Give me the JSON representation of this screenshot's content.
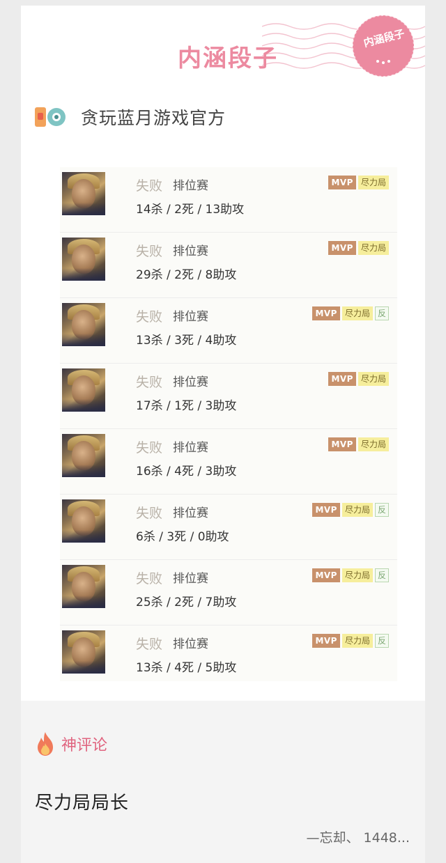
{
  "header": {
    "brand_title": "内涵段子",
    "stamp_text": "内涵段子",
    "brand_color": "#ec8aa0"
  },
  "author": {
    "icon": "game-app-icon",
    "name": "贪玩蓝月游戏官方"
  },
  "matches": [
    {
      "result": "失败",
      "mode": "排位赛",
      "kda": "14杀 / 2死 / 13助攻",
      "badges": [
        "MVP",
        "尽力局"
      ]
    },
    {
      "result": "失败",
      "mode": "排位赛",
      "kda": "29杀 / 2死 / 8助攻",
      "badges": [
        "MVP",
        "尽力局"
      ]
    },
    {
      "result": "失败",
      "mode": "排位赛",
      "kda": "13杀 / 3死 / 4助攻",
      "badges": [
        "MVP",
        "尽力局",
        "反"
      ]
    },
    {
      "result": "失败",
      "mode": "排位赛",
      "kda": "17杀 / 1死 / 3助攻",
      "badges": [
        "MVP",
        "尽力局"
      ]
    },
    {
      "result": "失败",
      "mode": "排位赛",
      "kda": "16杀 / 4死 / 3助攻",
      "badges": [
        "MVP",
        "尽力局"
      ]
    },
    {
      "result": "失败",
      "mode": "排位赛",
      "kda": "6杀 / 3死 / 0助攻",
      "badges": [
        "MVP",
        "尽力局",
        "反"
      ]
    },
    {
      "result": "失败",
      "mode": "排位赛",
      "kda": "25杀 / 2死 / 7助攻",
      "badges": [
        "MVP",
        "尽力局",
        "反"
      ]
    },
    {
      "result": "失败",
      "mode": "排位赛",
      "kda": "13杀 / 4死 / 5助攻",
      "badges": [
        "MVP",
        "尽力局",
        "反"
      ]
    }
  ],
  "watermark": "内涵段子",
  "comments": {
    "icon": "fire-icon",
    "header_label": "神评论",
    "text": "尽力局局长",
    "author": "—忘却、 1448..."
  }
}
